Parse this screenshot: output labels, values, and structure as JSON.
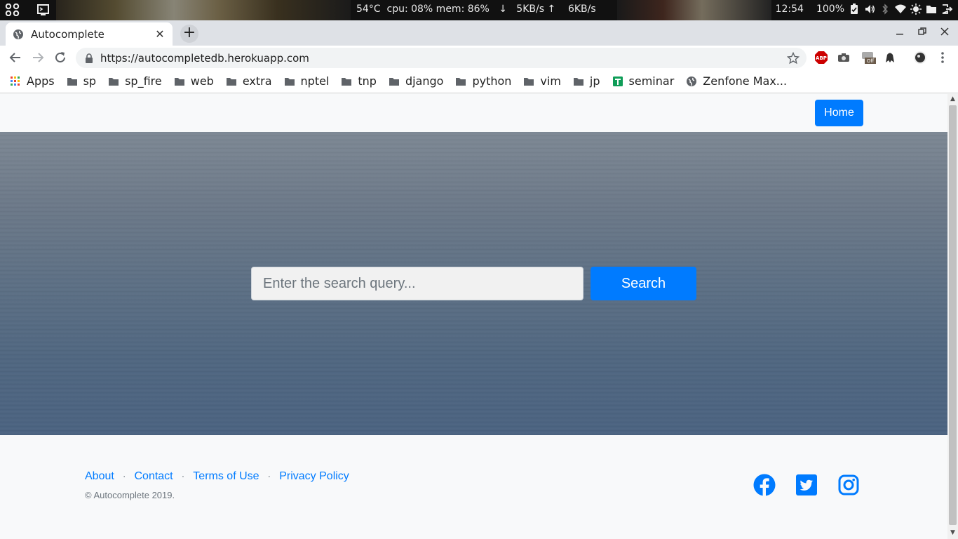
{
  "os_bar": {
    "stats": "54°C  cpu: 08% mem: 86%   ↓   5KB/s ↑    6KB/s",
    "clock": "12:54",
    "battery": "100%"
  },
  "browser": {
    "tab_title": "Autocomplete",
    "url": "https://autocompletedb.herokuapp.com",
    "new_tab_symbol": "+",
    "close_symbol": "✕"
  },
  "bookmarks": [
    {
      "label": "Apps",
      "icon": "apps-grid-icon"
    },
    {
      "label": "sp",
      "icon": "folder-icon"
    },
    {
      "label": "sp_fire",
      "icon": "folder-icon"
    },
    {
      "label": "web",
      "icon": "folder-icon"
    },
    {
      "label": "extra",
      "icon": "folder-icon"
    },
    {
      "label": "nptel",
      "icon": "folder-icon"
    },
    {
      "label": "tnp",
      "icon": "folder-icon"
    },
    {
      "label": "django",
      "icon": "folder-icon"
    },
    {
      "label": "python",
      "icon": "folder-icon"
    },
    {
      "label": "vim",
      "icon": "folder-icon"
    },
    {
      "label": "jp",
      "icon": "folder-icon"
    },
    {
      "label": "seminar",
      "icon": "sheets-icon"
    },
    {
      "label": "Zenfone Max...",
      "icon": "globe-icon"
    }
  ],
  "page": {
    "nav": {
      "home_label": "Home"
    },
    "search": {
      "placeholder": "Enter the search query...",
      "button_label": "Search"
    },
    "footer": {
      "links": [
        "About",
        "Contact",
        "Terms of Use",
        "Privacy Policy"
      ],
      "separator": "·",
      "copyright": "© Autocomplete 2019.",
      "social": [
        "facebook-icon",
        "twitter-icon",
        "instagram-icon"
      ]
    }
  },
  "colors": {
    "primary": "#007bff",
    "footer_bg": "#f8f9fa",
    "muted": "#6c757d"
  }
}
